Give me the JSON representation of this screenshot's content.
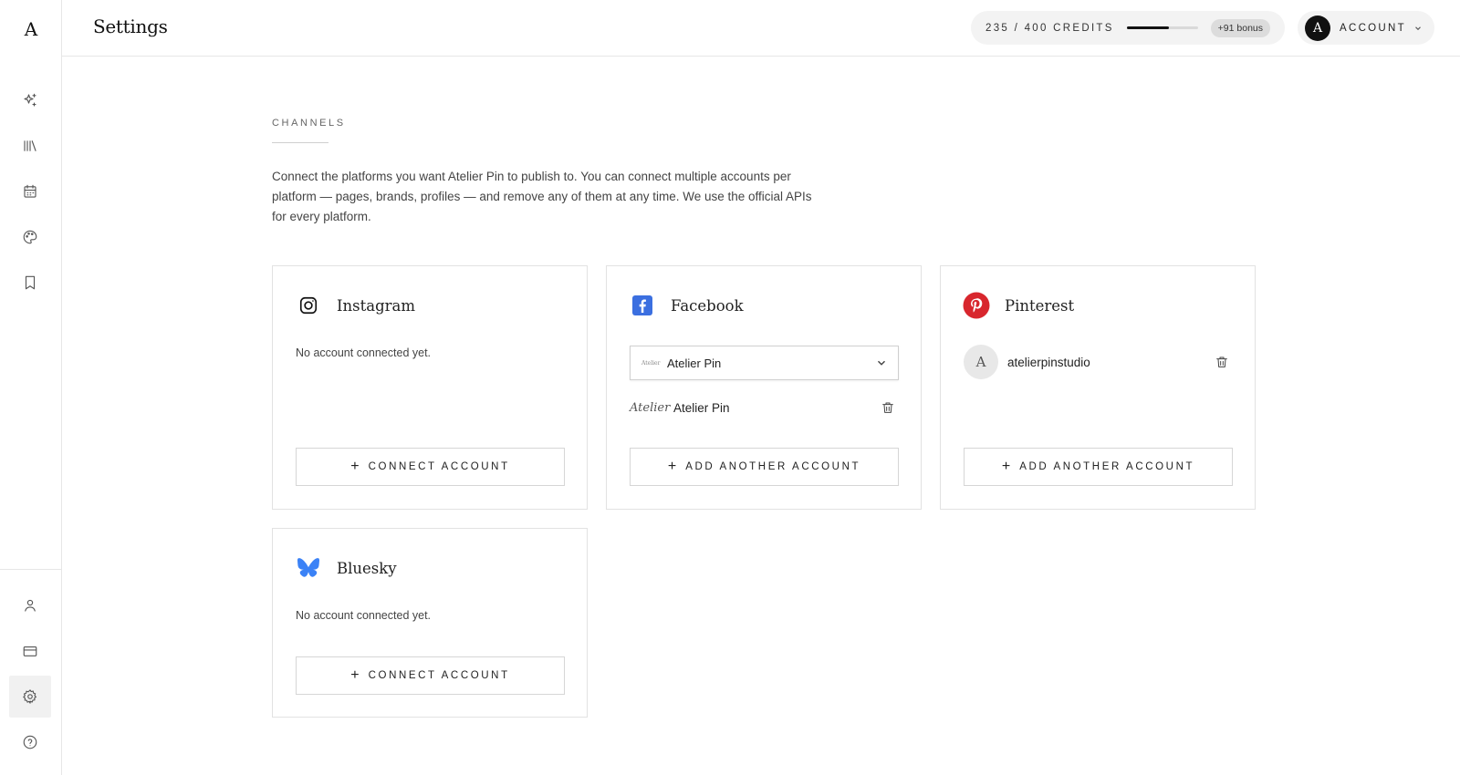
{
  "sidebar": {
    "logo": "A",
    "nav": [
      {
        "icon": "sparkles-icon"
      },
      {
        "icon": "library-icon"
      },
      {
        "icon": "calendar-icon"
      },
      {
        "icon": "palette-icon"
      },
      {
        "icon": "bookmark-icon"
      }
    ],
    "bottom_nav": [
      {
        "icon": "user-icon"
      },
      {
        "icon": "credit-card-icon"
      },
      {
        "icon": "settings-icon",
        "active": true
      },
      {
        "icon": "help-icon"
      }
    ]
  },
  "header": {
    "title": "Settings",
    "credits": {
      "text": "235 / 400 CREDITS",
      "used": 235,
      "total": 400,
      "bonus": "+91 bonus"
    },
    "account": {
      "avatar_letter": "A",
      "label": "ACCOUNT"
    }
  },
  "main": {
    "section_label": "CHANNELS",
    "intro": "Connect the platforms you want Atelier Pin to publish to. You can connect multiple accounts per platform — pages, brands, profiles — and remove any of them at any time. We use the official APIs for every platform.",
    "cards": {
      "instagram": {
        "name": "Instagram",
        "empty_note": "No account connected yet.",
        "button": "CONNECT ACCOUNT"
      },
      "facebook": {
        "name": "Facebook",
        "selected_page": "Atelier Pin",
        "select_logo": "Atelier",
        "accounts": [
          {
            "logo": "Atelier",
            "name": "Atelier Pin"
          }
        ],
        "button": "ADD ANOTHER ACCOUNT"
      },
      "pinterest": {
        "name": "Pinterest",
        "accounts": [
          {
            "avatar_letter": "A",
            "name": "atelierpinstudio"
          }
        ],
        "button": "ADD ANOTHER ACCOUNT"
      },
      "bluesky": {
        "name": "Bluesky",
        "empty_note": "No account connected yet.",
        "button": "CONNECT ACCOUNT"
      }
    },
    "plus_glyph": "+"
  },
  "colors": {
    "facebook": "#3b6fe0",
    "pinterest": "#d8262d",
    "bluesky": "#3b82f6",
    "accent": "#111111"
  }
}
